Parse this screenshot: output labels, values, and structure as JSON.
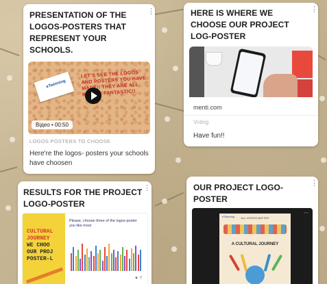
{
  "cards": [
    {
      "title": "PRESENTATION OF THE LOGOS-POSTERS THAT REPRESENT YOUR SCHOOLS.",
      "thumbnail": {
        "logo_text": "eTwinning",
        "poster_text": "LET'S SEE THE LOGOS AND POSTERS YOU HAVE MADE!! THEY ARE ALL REALLY FANTASTIC!!",
        "badge": "Відео • 00:50"
      },
      "category": "LOGOS POSTERS TO CHOOSE",
      "description": "Here're the logos- posters your schools have choosen"
    },
    {
      "title": "HERE IS WHERE WE CHOOSE OUR PROJECT LOG-POSTER",
      "source": "menti.com",
      "kind": "Voting",
      "description": "Have fun!!"
    },
    {
      "title": "RESULTS FOR THE PROJECT LOGO-POSTER",
      "thumbnail": {
        "left_text_lines": [
          "CULTURAL",
          "JOURNEY",
          "WE CHOO",
          "OUR PROJ",
          "POSTER-L"
        ],
        "poll_title": "Please, choose three of the logos-poster you like most",
        "footer": "▼ ?"
      }
    },
    {
      "title": "OUR PROJECT LOGO-POSTER",
      "thumbnail": {
        "brand": "eTwinning",
        "tagline": "· ALL VOICES MATTER ·",
        "headline": "A CULTURAL JOURNEY"
      }
    }
  ],
  "menu_icon": "more-vertical-icon",
  "colors": {
    "board_background": "#c9b89a",
    "card_background": "#ffffff",
    "play_button": "#111111",
    "poster_red_text": "#c62424",
    "yellow_block": "#f4d33a"
  },
  "chart_bars": [
    {
      "c": "#e3473a",
      "v": 0.6
    },
    {
      "c": "#3a7fd1",
      "v": 0.8
    },
    {
      "c": "#f2a73b",
      "v": 0.5
    },
    {
      "c": "#5bb45a",
      "v": 0.7
    },
    {
      "c": "#8a4fc1",
      "v": 0.4
    },
    {
      "c": "#e3473a",
      "v": 0.9
    },
    {
      "c": "#3a7fd1",
      "v": 0.55
    },
    {
      "c": "#f2a73b",
      "v": 0.75
    },
    {
      "c": "#5bb45a",
      "v": 0.45
    },
    {
      "c": "#8a4fc1",
      "v": 0.65
    },
    {
      "c": "#e3473a",
      "v": 0.5
    },
    {
      "c": "#3a7fd1",
      "v": 0.85
    },
    {
      "c": "#f2a73b",
      "v": 0.6
    },
    {
      "c": "#5bb45a",
      "v": 0.7
    },
    {
      "c": "#8a4fc1",
      "v": 0.35
    },
    {
      "c": "#e3473a",
      "v": 0.8
    },
    {
      "c": "#3a7fd1",
      "v": 0.5
    },
    {
      "c": "#f2a73b",
      "v": 0.9
    },
    {
      "c": "#5bb45a",
      "v": 0.6
    },
    {
      "c": "#8a4fc1",
      "v": 0.7
    },
    {
      "c": "#e3473a",
      "v": 0.45
    },
    {
      "c": "#3a7fd1",
      "v": 0.65
    },
    {
      "c": "#f2a73b",
      "v": 0.55
    },
    {
      "c": "#5bb45a",
      "v": 0.8
    },
    {
      "c": "#8a4fc1",
      "v": 0.5
    },
    {
      "c": "#e3473a",
      "v": 0.7
    },
    {
      "c": "#3a7fd1",
      "v": 0.4
    },
    {
      "c": "#f2a73b",
      "v": 0.75
    },
    {
      "c": "#5bb45a",
      "v": 0.6
    },
    {
      "c": "#8a4fc1",
      "v": 0.85
    },
    {
      "c": "#e3473a",
      "v": 0.55
    },
    {
      "c": "#3a7fd1",
      "v": 0.7
    }
  ]
}
